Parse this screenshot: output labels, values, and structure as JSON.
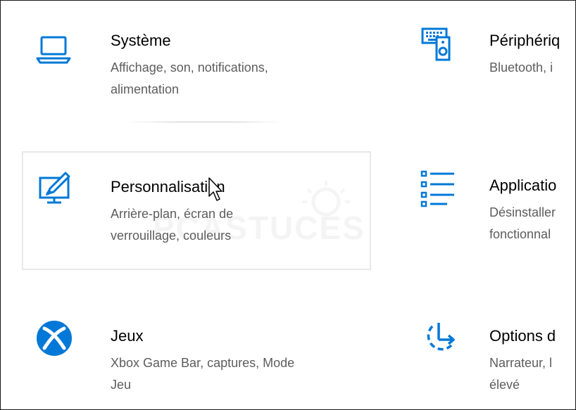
{
  "accent_color": "#0078d7",
  "tiles": [
    {
      "icon": "laptop-icon",
      "title": "Système",
      "desc_line1": "Affichage, son, notifications,",
      "desc_line2": "alimentation"
    },
    {
      "icon": "devices-icon",
      "title": "Périphériq",
      "desc_line1": "Bluetooth, i"
    },
    {
      "icon": "personalization-icon",
      "title": "Personnalisation",
      "desc_line1": "Arrière-plan, écran de",
      "desc_line2": "verrouillage, couleurs"
    },
    {
      "icon": "apps-icon",
      "title": "Applicatio",
      "desc_line1": "Désinstaller",
      "desc_line2": "fonctionnal"
    },
    {
      "icon": "xbox-icon",
      "title": "Jeux",
      "desc_line1": "Xbox Game Bar, captures, Mode",
      "desc_line2": "Jeu"
    },
    {
      "icon": "ease-of-access-icon",
      "title": "Options d",
      "desc_line1": "Narrateur, l",
      "desc_line2": "élevé"
    }
  ],
  "watermark": {
    "text": "PCASTUCES"
  }
}
